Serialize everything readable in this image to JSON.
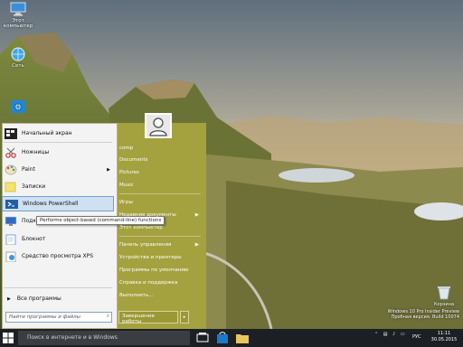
{
  "desktop": {
    "icons": [
      {
        "label": "Этот компьютер",
        "icon": "computer-icon"
      },
      {
        "label": "Сеть",
        "icon": "network-globe-icon"
      },
      {
        "label": "",
        "icon": "control-panel-icon"
      }
    ],
    "recycle_bin": "Корзина",
    "watermark": {
      "line1": "Windows 10 Pro Insider Preview",
      "line2": "Пробная версия. Build 10074"
    }
  },
  "start_menu": {
    "left_items": [
      {
        "label": "Начальный экран",
        "icon": "start-screen-icon",
        "has_submenu": false
      },
      {
        "label": "Ножницы",
        "icon": "scissors-icon",
        "has_submenu": false
      },
      {
        "label": "Paint",
        "icon": "paint-palette-icon",
        "has_submenu": true
      },
      {
        "label": "Записки",
        "icon": "sticky-notes-icon",
        "has_submenu": false
      },
      {
        "label": "Windows PowerShell",
        "icon": "powershell-icon",
        "has_submenu": false,
        "selected": true
      },
      {
        "label": "Подк... работы...",
        "icon": "remote-desktop-icon",
        "has_submenu": false
      },
      {
        "label": "Блокнот",
        "icon": "notepad-icon",
        "has_submenu": false
      },
      {
        "label": "Средство просмотра XPS",
        "icon": "xps-viewer-icon",
        "has_submenu": false
      }
    ],
    "all_programs": "Все программы",
    "search_placeholder": "Найти программы и файлы",
    "tooltip": "Performs object-based (command-line) functions",
    "right_items": [
      {
        "label": "comp",
        "has_submenu": false
      },
      {
        "label": "Documents",
        "has_submenu": false
      },
      {
        "label": "Pictures",
        "has_submenu": false
      },
      {
        "label": "Music",
        "has_submenu": false
      },
      {
        "label": "Игры",
        "has_submenu": false
      },
      {
        "label": "Недавние документы",
        "has_submenu": true
      },
      {
        "label": "Этот компьютер",
        "has_submenu": false
      },
      {
        "label": "Панель управления",
        "has_submenu": true
      },
      {
        "label": "Устройства и принтеры",
        "has_submenu": false
      },
      {
        "label": "Программы по умолчанию",
        "has_submenu": false
      },
      {
        "label": "Справка и поддержка",
        "has_submenu": false
      },
      {
        "label": "Выполнить...",
        "has_submenu": false
      }
    ],
    "shutdown_label": "Завершение работы",
    "shutdown_arrow": "▸"
  },
  "taskbar": {
    "search_placeholder": "Поиск в интернете и в Windows",
    "language": "РУС",
    "time": "11:11",
    "date": "30.05.2015"
  },
  "colors": {
    "menu_right_bg": "#a4a23e",
    "taskbar_bg": "#1c1f24",
    "selection": "#cfe0f0"
  }
}
